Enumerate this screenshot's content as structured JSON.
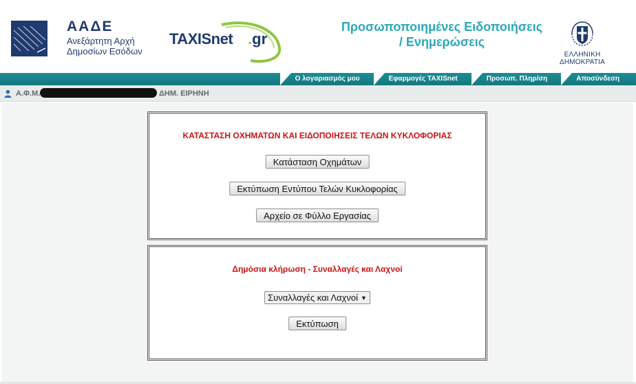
{
  "header": {
    "aade_abbr": "ΑΑΔΕ",
    "aade_line1": "Ανεξάρτητη Αρχή",
    "aade_line2": "Δημοσίων Εσόδων",
    "taxis_brand": "TAXISnet",
    "taxis_dot": ".",
    "taxis_tld": "gr",
    "notif_line1": "Προσωποποιημένες Ειδοποιήσεις",
    "notif_line2": "/ Ενημερώσεις",
    "gov_label": "ΕΛΛΗΝΙΚΗ ΔΗΜΟΚΡΑΤΙΑ"
  },
  "nav": {
    "items": [
      {
        "label": "Ο λογαριασμός μου"
      },
      {
        "label": "Εφαρμογές TAXISnet"
      },
      {
        "label": "Προσωπ. Πληρ/ση"
      },
      {
        "label": "Αποσύνδεση"
      }
    ]
  },
  "user": {
    "afm_label": "Α.Φ.Μ.",
    "name": "ΔΗΜ. ΕΙΡΗΝΗ"
  },
  "vehicles": {
    "title": "ΚΑΤΑΣΤΑΣΗ ΟΧΗΜΑΤΩΝ ΚΑΙ ΕΙΔΟΠΟΙΗΣΕΙΣ ΤΕΛΩΝ ΚΥΚΛΟΦΟΡΙΑΣ",
    "status_button": "Κατάσταση Οχημάτων",
    "print_button": "Εκτύπωση Εντύπου Τελών Κυκλοφορίας",
    "spreadsheet_button": "Αρχείο σε Φύλλο Εργασίας"
  },
  "lottery": {
    "title": "Δημόσια κλήρωση - Συναλλαγές και Λαχνοί",
    "select_value": "Συναλλαγές και Λαχνοί",
    "print_button": "Εκτύπωση"
  },
  "colors": {
    "brand_navy": "#1e3a6e",
    "accent_teal": "#2aa8b8",
    "nav_teal": "#147880",
    "title_red": "#cc1111"
  }
}
